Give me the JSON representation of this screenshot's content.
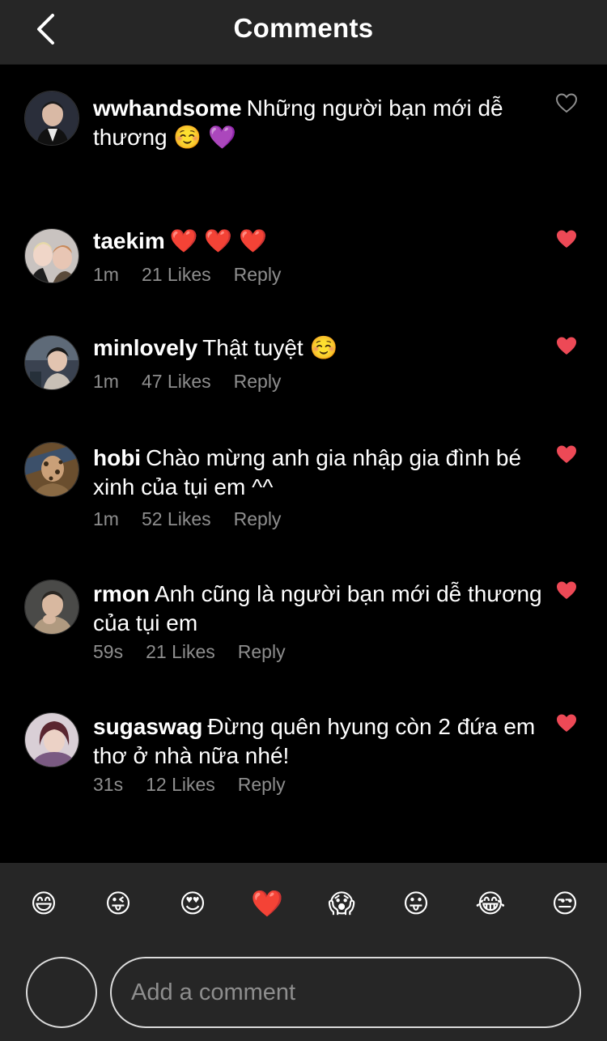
{
  "header": {
    "title": "Comments"
  },
  "comments": [
    {
      "username": "wwhandsome",
      "text": "Những người bạn mới dễ thương ☺️ 💜",
      "liked": false
    },
    {
      "username": "taekim",
      "text": "❤️ ❤️ ❤️",
      "time": "1m",
      "likes": "21 Likes",
      "reply": "Reply",
      "liked": true
    },
    {
      "username": "minlovely",
      "text": "Thật tuyệt ☺️",
      "time": "1m",
      "likes": "47 Likes",
      "reply": "Reply",
      "liked": true
    },
    {
      "username": "hobi",
      "text": "Chào mừng anh gia nhập gia đình bé xinh của tụi em ^^",
      "time": "1m",
      "likes": "52 Likes",
      "reply": "Reply",
      "liked": true
    },
    {
      "username": "rmon",
      "text": "Anh cũng là người bạn mới dễ thương của tụi em",
      "time": "59s",
      "likes": "21 Likes",
      "reply": "Reply",
      "liked": true
    },
    {
      "username": "sugaswag",
      "text": "Đừng quên hyung còn 2 đứa em thơ ở nhà nữa nhé!",
      "time": "31s",
      "likes": "12 Likes",
      "reply": "Reply",
      "liked": true
    }
  ],
  "emoji_bar": [
    "😄",
    "😜",
    "😍",
    "❤️",
    "😱",
    "😛",
    "😂",
    "😒"
  ],
  "input": {
    "placeholder": "Add a comment"
  },
  "colors": {
    "header_bg": "#262626",
    "heart_liked": "#ed4956",
    "meta_text": "#8e8e8e"
  }
}
